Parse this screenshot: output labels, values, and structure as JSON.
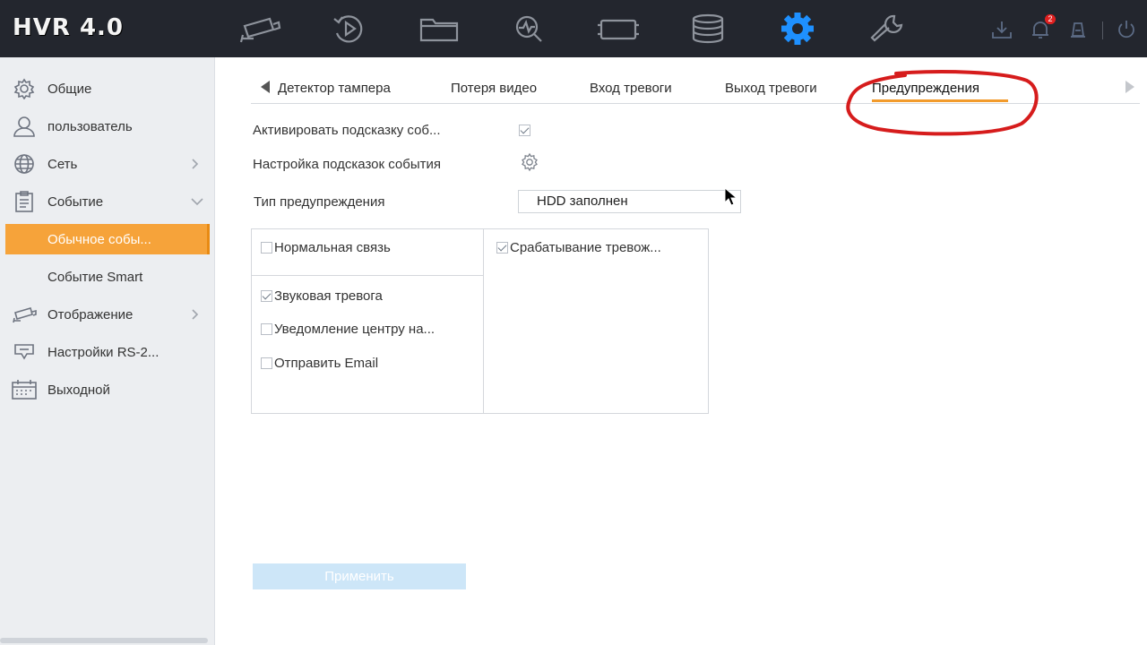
{
  "app": {
    "logo": "HVR 4.0",
    "notification_count": "2"
  },
  "topnav": {
    "icons": [
      "camera-icon",
      "playback-icon",
      "folder-icon",
      "search-icon",
      "video-icon",
      "storage-icon",
      "settings-icon",
      "maintenance-icon"
    ],
    "active": "settings-icon"
  },
  "system_icons": [
    "download-icon",
    "bell-icon",
    "lock-icon",
    "power-icon"
  ],
  "sidebar": {
    "items": [
      {
        "label": "Общие",
        "icon": "gear-icon"
      },
      {
        "label": "пользователь",
        "icon": "user-icon"
      },
      {
        "label": "Сеть",
        "icon": "globe-icon"
      },
      {
        "label": "Событие",
        "icon": "clipboard-icon"
      },
      {
        "label": "Обычное собы...",
        "icon": ""
      },
      {
        "label": "Событие Smart",
        "icon": ""
      },
      {
        "label": "Отображение",
        "icon": "camera-icon"
      },
      {
        "label": "Настройки RS-2...",
        "icon": "chat-icon"
      },
      {
        "label": "Выходной",
        "icon": "calendar-icon"
      }
    ],
    "active_label": "Обычное собы..."
  },
  "tabs": {
    "items": [
      "Детектор тампера",
      "Потеря видео",
      "Вход тревоги",
      "Выход тревоги",
      "Предупреждения"
    ],
    "active": "Предупреждения"
  },
  "form": {
    "enable_hint_label": "Активировать подсказку соб...",
    "enable_hint_checked": true,
    "hint_settings_label": "Настройка подсказок события",
    "warning_type_label": "Тип предупреждения",
    "warning_type_value": "HDD заполнен"
  },
  "linkage": {
    "normal_label": "Нормальная связь",
    "normal_checked": false,
    "trigger_label": "Срабатывание тревож...",
    "trigger_checked": true,
    "actions": [
      {
        "label": "Звуковая тревога",
        "checked": true
      },
      {
        "label": "Уведомление центру на...",
        "checked": false
      },
      {
        "label": "Отправить Email",
        "checked": false
      }
    ]
  },
  "apply_label": "Применить",
  "colors": {
    "topbar": "#23262e",
    "accent": "#f6a33a",
    "active_icon": "#1e90ff",
    "annotation": "#d61c1c"
  }
}
